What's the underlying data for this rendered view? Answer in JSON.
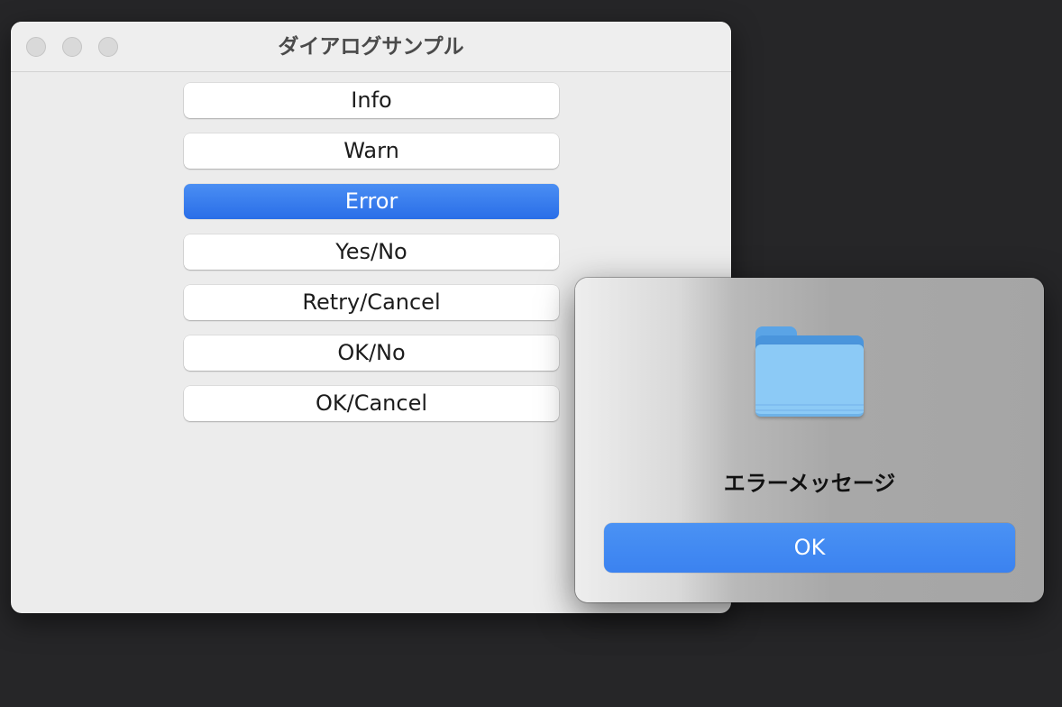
{
  "window": {
    "title": "ダイアログサンプル"
  },
  "buttons": [
    {
      "label": "Info",
      "active": false
    },
    {
      "label": "Warn",
      "active": false
    },
    {
      "label": "Error",
      "active": true
    },
    {
      "label": "Yes/No",
      "active": false
    },
    {
      "label": "Retry/Cancel",
      "active": false
    },
    {
      "label": "OK/No",
      "active": false
    },
    {
      "label": "OK/Cancel",
      "active": false
    }
  ],
  "alert": {
    "icon": "folder-icon",
    "message": "エラーメッセージ",
    "ok_label": "OK"
  },
  "colors": {
    "accent": "#2f72ea",
    "folder": "#8ccaf6",
    "background": "#262628"
  }
}
